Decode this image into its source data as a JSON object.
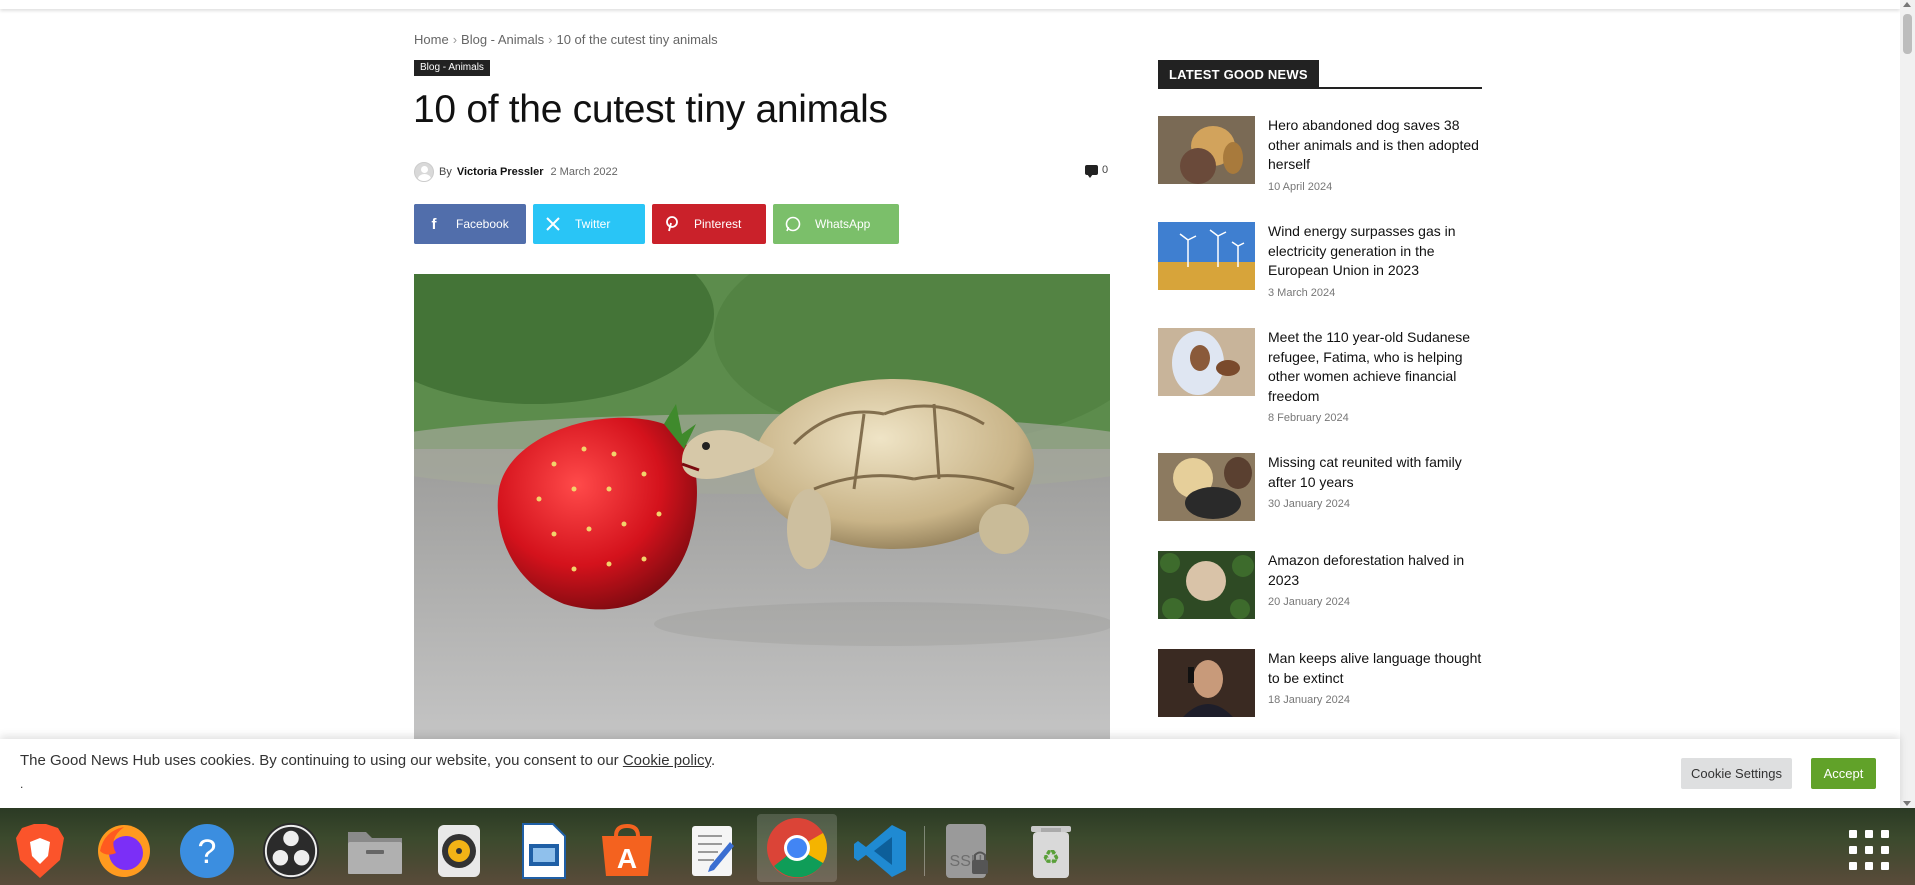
{
  "breadcrumb": {
    "home": "Home",
    "category": "Blog - Animals",
    "current": "10 of the cutest tiny animals",
    "separator": "›"
  },
  "article": {
    "category_tag": "Blog - Animals",
    "title": "10 of the cutest tiny animals",
    "by_label": "By",
    "author": "Victoria Pressler",
    "date": "2 March 2022",
    "comment_count": "0"
  },
  "share": {
    "facebook": "Facebook",
    "twitter": "Twitter",
    "pinterest": "Pinterest",
    "whatsapp": "WhatsApp"
  },
  "sidebar": {
    "heading": "LATEST GOOD NEWS",
    "items": [
      {
        "headline": "Hero abandoned dog saves 38 other animals and is then adopted herself",
        "date": "10 April 2024"
      },
      {
        "headline": "Wind energy surpasses gas in electricity generation in the European Union in 2023",
        "date": "3 March 2024"
      },
      {
        "headline": "Meet the 110 year-old Sudanese refugee, Fatima, who is helping other women achieve financial freedom",
        "date": "8 February 2024"
      },
      {
        "headline": "Missing cat reunited with family after 10 years",
        "date": "30 January 2024"
      },
      {
        "headline": "Amazon deforestation halved in 2023",
        "date": "20 January 2024"
      },
      {
        "headline": "Man keeps alive language thought to be extinct",
        "date": "18 January 2024"
      }
    ]
  },
  "cookie": {
    "text": "The Good News Hub uses cookies. By continuing to using our website, you consent to our",
    "link": "Cookie policy",
    "period": ".",
    "second_line": ".",
    "settings_label": "Cookie Settings",
    "accept_label": "Accept"
  },
  "colors": {
    "facebook": "#516eab",
    "twitter": "#29c5f6",
    "pinterest": "#ca212a",
    "whatsapp": "#7bbf6a",
    "accept": "#61a229"
  },
  "taskbar": {
    "apps": [
      "brave-icon",
      "firefox-icon",
      "help-icon",
      "obs-icon",
      "files-icon",
      "rhythmbox-icon",
      "libreoffice-impress-icon",
      "app-store-icon",
      "text-editor-icon",
      "chrome-icon",
      "vscode-icon",
      "ssh-icon",
      "trash-icon",
      "apps-grid-icon"
    ]
  }
}
